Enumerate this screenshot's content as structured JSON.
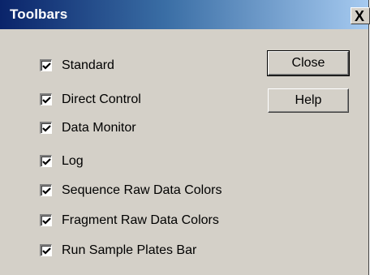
{
  "window": {
    "title": "Toolbars",
    "close_glyph": "X"
  },
  "options": [
    {
      "label": "Standard",
      "checked": true
    },
    {
      "label": "Direct Control",
      "checked": true
    },
    {
      "label": "Data Monitor",
      "checked": true
    },
    {
      "label": "Log",
      "checked": true
    },
    {
      "label": "Sequence Raw Data Colors",
      "checked": true
    },
    {
      "label": "Fragment Raw Data Colors",
      "checked": true
    },
    {
      "label": "Run Sample Plates Bar",
      "checked": true
    }
  ],
  "buttons": {
    "close_label": "Close",
    "help_label": "Help"
  },
  "icons": {
    "checkbox_mark": "checkmark-icon",
    "title_close": "close-icon"
  },
  "colors": {
    "title_start": "#0a246a",
    "title_end": "#a6caf0",
    "face": "#d4d0c8"
  }
}
